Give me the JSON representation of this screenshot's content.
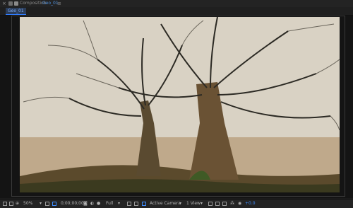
{
  "window": {
    "title_prefix": "Composition",
    "comp_name": "Geo_01",
    "close_glyph": "×",
    "menu_glyph": "≡"
  },
  "tab": {
    "label": "Geo_01"
  },
  "viewer": {
    "image_description_icon": "photo-trees"
  },
  "bottombar": {
    "zoom": "50%",
    "timecode": "0;00;00;00",
    "resolution": "Full",
    "camera": "Active Camera",
    "views": "1 View",
    "exposure": "+0.0"
  },
  "colors": {
    "accent": "#3e8cff",
    "panel_bg": "#1c1c1c"
  }
}
